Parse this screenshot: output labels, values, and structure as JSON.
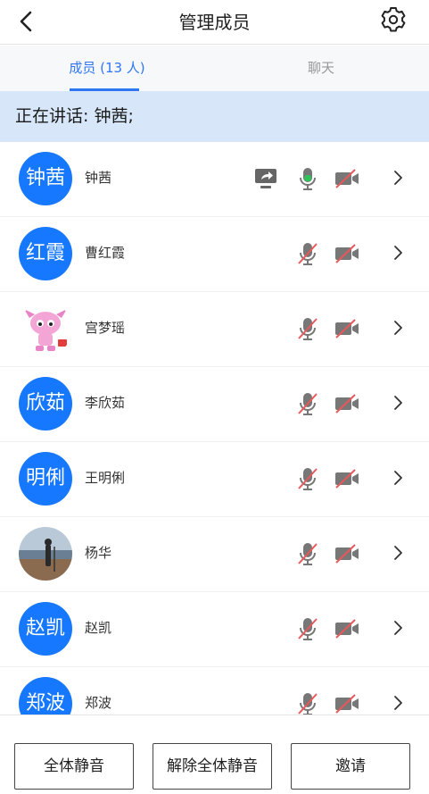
{
  "header": {
    "title": "管理成员"
  },
  "tabs": [
    {
      "label": "成员 (13 人)",
      "active": true
    },
    {
      "label": "聊天",
      "active": false
    }
  ],
  "speaking": {
    "text": "正在讲话: 钟茜;"
  },
  "members": [
    {
      "avatar_text": "钟茜",
      "name": "钟茜",
      "sharing": true,
      "mic_on": true,
      "cam_on": false
    },
    {
      "avatar_text": "红霞",
      "name": "曹红霞",
      "sharing": false,
      "mic_on": false,
      "cam_on": false
    },
    {
      "avatar_text": "",
      "name": "宫梦瑶",
      "sharing": false,
      "mic_on": false,
      "cam_on": false,
      "avatar_image": "cartoon-pink-character"
    },
    {
      "avatar_text": "欣茹",
      "name": "李欣茹",
      "sharing": false,
      "mic_on": false,
      "cam_on": false
    },
    {
      "avatar_text": "明俐",
      "name": "王明俐",
      "sharing": false,
      "mic_on": false,
      "cam_on": false
    },
    {
      "avatar_text": "",
      "name": "杨华",
      "sharing": false,
      "mic_on": false,
      "cam_on": false,
      "avatar_image": "seaside-photo"
    },
    {
      "avatar_text": "赵凯",
      "name": "赵凯",
      "sharing": false,
      "mic_on": false,
      "cam_on": false
    },
    {
      "avatar_text": "郑波",
      "name": "郑波",
      "sharing": false,
      "mic_on": false,
      "cam_on": false
    }
  ],
  "footer": {
    "mute_all": "全体静音",
    "unmute_all": "解除全体静音",
    "invite": "邀请"
  },
  "colors": {
    "accent": "#2f76f5",
    "avatar": "#1677ff",
    "banner": "#d7e7f9",
    "mic_on": "#2fc25b",
    "muted": "#e8585a"
  },
  "icons": [
    "back-icon",
    "gear-icon",
    "screen-share-icon",
    "microphone-icon",
    "microphone-off-icon",
    "camera-off-icon",
    "chevron-right-icon"
  ]
}
